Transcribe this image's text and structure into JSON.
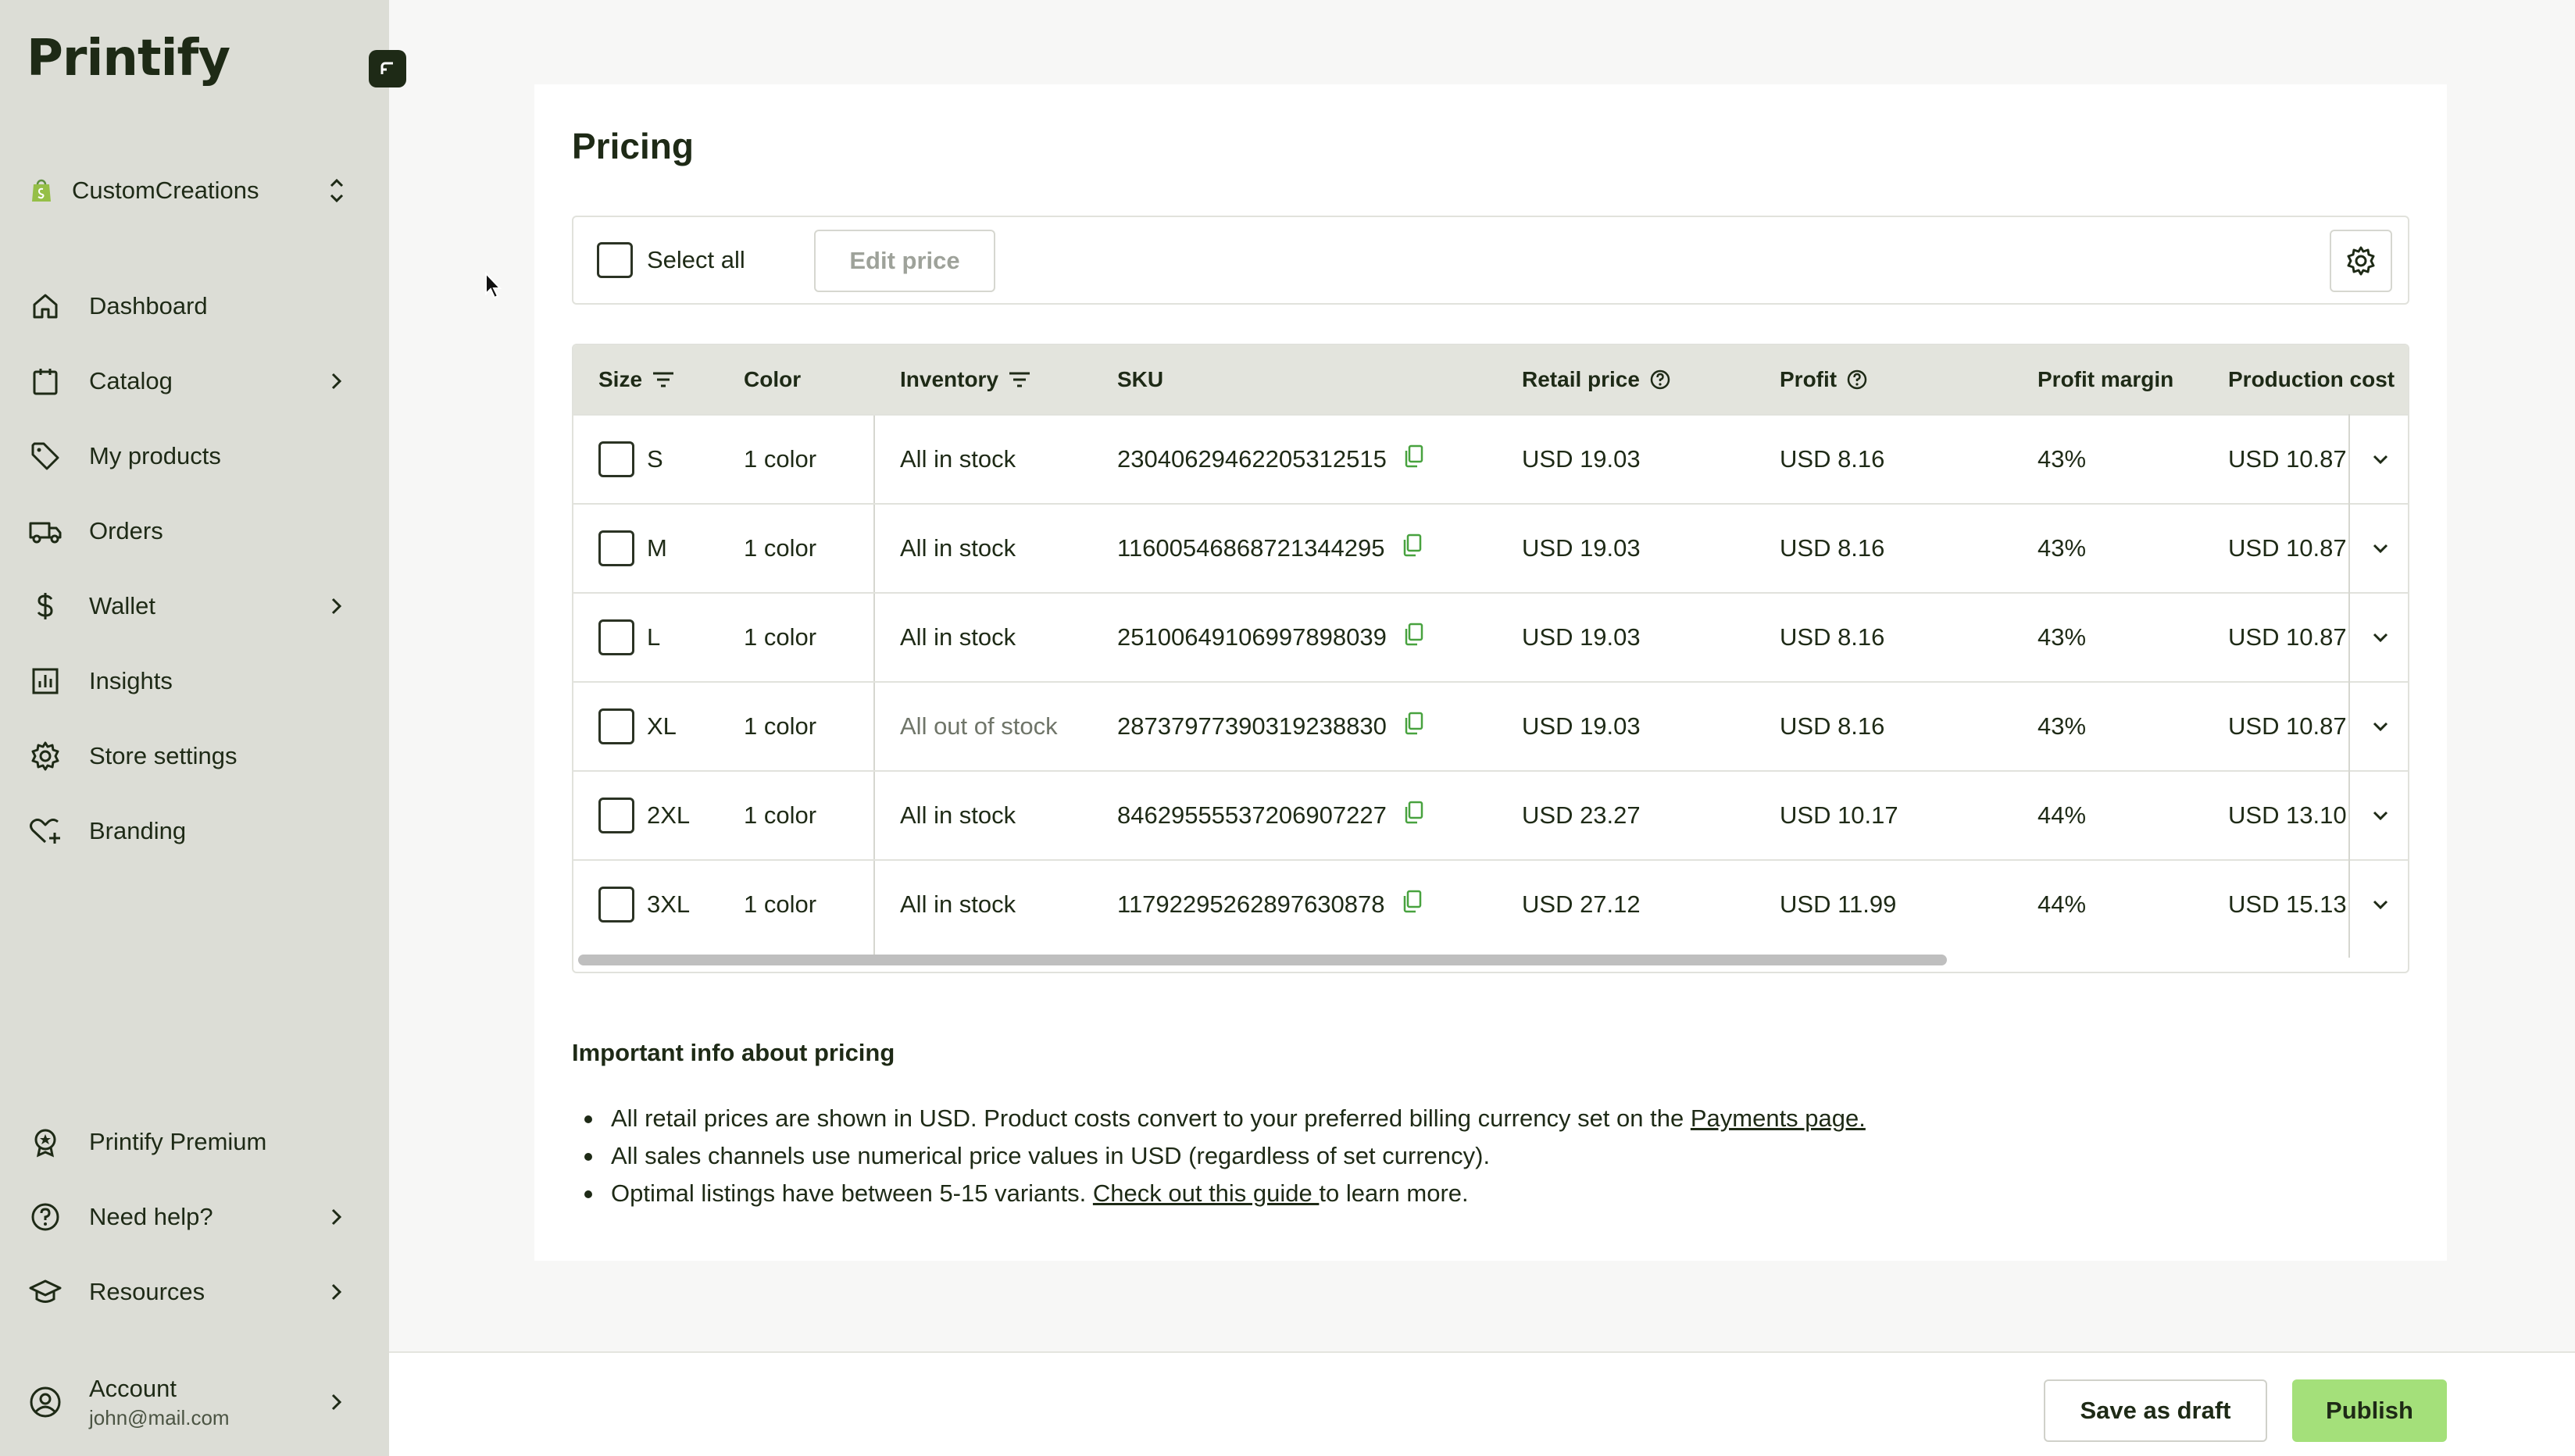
{
  "app": {
    "logo": "Printify",
    "accent": "#a4e07a"
  },
  "store": {
    "name": "CustomCreations"
  },
  "sidebar": {
    "items": [
      {
        "label": "Dashboard",
        "icon": "home-icon",
        "has_arrow": false
      },
      {
        "label": "Catalog",
        "icon": "clipboard-icon",
        "has_arrow": true
      },
      {
        "label": "My products",
        "icon": "tag-icon",
        "has_arrow": false
      },
      {
        "label": "Orders",
        "icon": "truck-icon",
        "has_arrow": false
      },
      {
        "label": "Wallet",
        "icon": "dollar-icon",
        "has_arrow": true
      },
      {
        "label": "Insights",
        "icon": "chart-icon",
        "has_arrow": false
      },
      {
        "label": "Store settings",
        "icon": "gear-icon",
        "has_arrow": false
      },
      {
        "label": "Branding",
        "icon": "heart-plus-icon",
        "has_arrow": false
      }
    ],
    "bottom_items": [
      {
        "label": "Printify Premium",
        "icon": "badge-icon",
        "has_arrow": false
      },
      {
        "label": "Need help?",
        "icon": "help-icon",
        "has_arrow": true
      },
      {
        "label": "Resources",
        "icon": "graduation-icon",
        "has_arrow": true
      }
    ],
    "account": {
      "label": "Account",
      "email": "john@mail.com"
    }
  },
  "pricing": {
    "title": "Pricing",
    "select_all": "Select all",
    "edit_price": "Edit price",
    "columns": {
      "size": "Size",
      "color": "Color",
      "inventory": "Inventory",
      "sku": "SKU",
      "retail": "Retail price",
      "profit": "Profit",
      "margin": "Profit margin",
      "production": "Production cost"
    },
    "rows": [
      {
        "size": "S",
        "color": "1 color",
        "inventory": "All in stock",
        "sku": "23040629462205312515",
        "retail": "USD 19.03",
        "profit": "USD 8.16",
        "margin": "43%",
        "production": "USD 10.87"
      },
      {
        "size": "M",
        "color": "1 color",
        "inventory": "All in stock",
        "sku": "11600546868721344295",
        "retail": "USD 19.03",
        "profit": "USD 8.16",
        "margin": "43%",
        "production": "USD 10.87"
      },
      {
        "size": "L",
        "color": "1 color",
        "inventory": "All in stock",
        "sku": "25100649106997898039",
        "retail": "USD 19.03",
        "profit": "USD 8.16",
        "margin": "43%",
        "production": "USD 10.87"
      },
      {
        "size": "XL",
        "color": "1 color",
        "inventory": "All out of stock",
        "sku": "28737977390319238830",
        "retail": "USD 19.03",
        "profit": "USD 8.16",
        "margin": "43%",
        "production": "USD 10.87"
      },
      {
        "size": "2XL",
        "color": "1 color",
        "inventory": "All in stock",
        "sku": "84629555537206907227",
        "retail": "USD 23.27",
        "profit": "USD 10.17",
        "margin": "44%",
        "production": "USD 13.10"
      },
      {
        "size": "3XL",
        "color": "1 color",
        "inventory": "All in stock",
        "sku": "11792295262897630878",
        "retail": "USD 27.12",
        "profit": "USD 11.99",
        "margin": "44%",
        "production": "USD 15.13"
      }
    ]
  },
  "info": {
    "title": "Important info about pricing",
    "line1_text": "All retail prices are shown in USD. Product costs convert to your preferred billing currency set on the ",
    "line1_link": "Payments page.",
    "line2_text": "All sales channels use numerical price values in USD (regardless of set currency).",
    "line3_text": "Optimal listings have between 5-15 variants. ",
    "line3_link": "Check out this guide ",
    "line3_after": "to learn more."
  },
  "footer": {
    "draft": "Save as draft",
    "publish": "Publish"
  }
}
